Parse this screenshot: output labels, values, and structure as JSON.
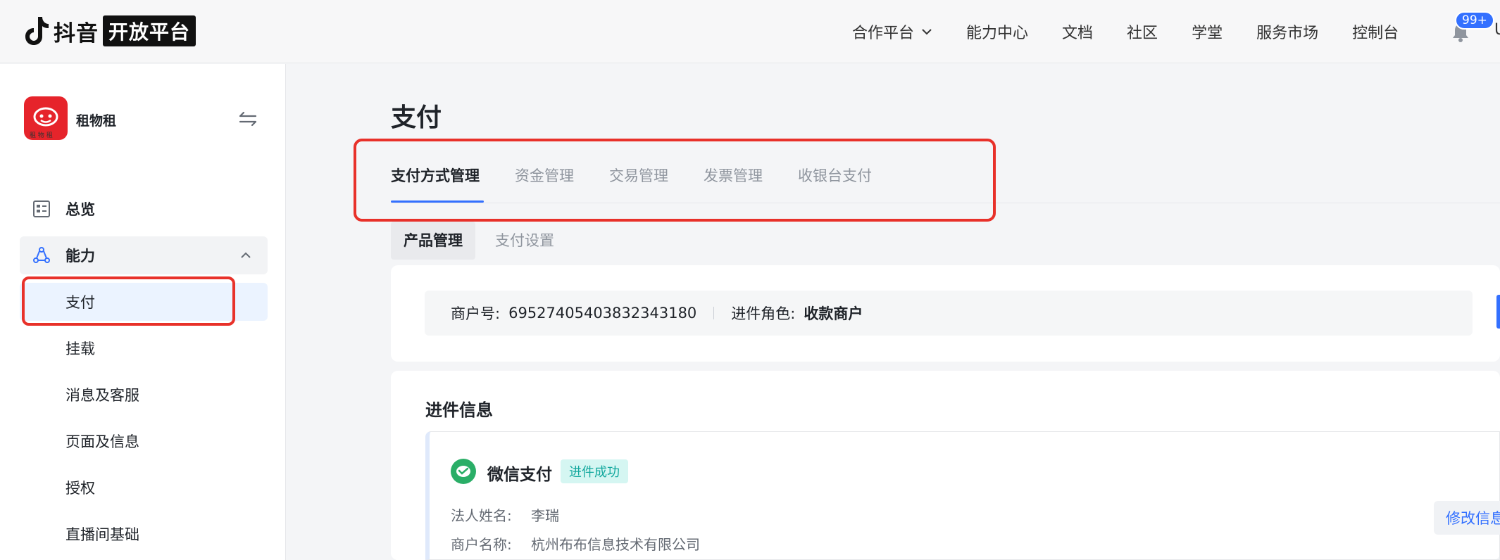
{
  "header": {
    "logo_text": "抖音",
    "logo_badge": "开放平台",
    "nav": [
      {
        "label": "合作平台",
        "has_dropdown": true
      },
      {
        "label": "能力中心"
      },
      {
        "label": "文档"
      },
      {
        "label": "社区"
      },
      {
        "label": "学堂"
      },
      {
        "label": "服务市场"
      },
      {
        "label": "控制台"
      }
    ],
    "notifications_badge": "99+",
    "user_initial": "U"
  },
  "sidebar": {
    "app_name": "租物租",
    "app_logo_caption": "租 物 租",
    "items": [
      {
        "label": "总览",
        "icon": "overview-icon"
      },
      {
        "label": "能力",
        "icon": "capability-icon",
        "expanded": true
      },
      {
        "label": "支付",
        "active": true
      },
      {
        "label": "挂载"
      },
      {
        "label": "消息及客服"
      },
      {
        "label": "页面及信息"
      },
      {
        "label": "授权"
      },
      {
        "label": "直播间基础"
      }
    ]
  },
  "main": {
    "title": "支付",
    "tabs": [
      {
        "label": "支付方式管理",
        "active": true
      },
      {
        "label": "资金管理"
      },
      {
        "label": "交易管理"
      },
      {
        "label": "发票管理"
      },
      {
        "label": "收银台支付"
      }
    ],
    "subtabs": [
      {
        "label": "产品管理",
        "active": true
      },
      {
        "label": "支付设置"
      }
    ],
    "merchant": {
      "id_label": "商户号:",
      "id_value": "69527405403832343180",
      "role_label": "进件角色:",
      "role_value": "收款商户"
    },
    "onboarding": {
      "section_title": "进件信息",
      "provider_name": "微信支付",
      "status": "进件成功",
      "fields": [
        {
          "label": "法人姓名:",
          "value": "李瑞"
        },
        {
          "label": "商户名称:",
          "value": "杭州布布信息技术有限公司"
        }
      ],
      "edit_button": "修改信息"
    }
  },
  "colors": {
    "accent": "#3370ff",
    "highlight": "#e8312a",
    "success_bg": "#d5f6f2",
    "success_text": "#13a89e",
    "app_logo": "#e6242b",
    "wechat_green": "#2aae67"
  }
}
